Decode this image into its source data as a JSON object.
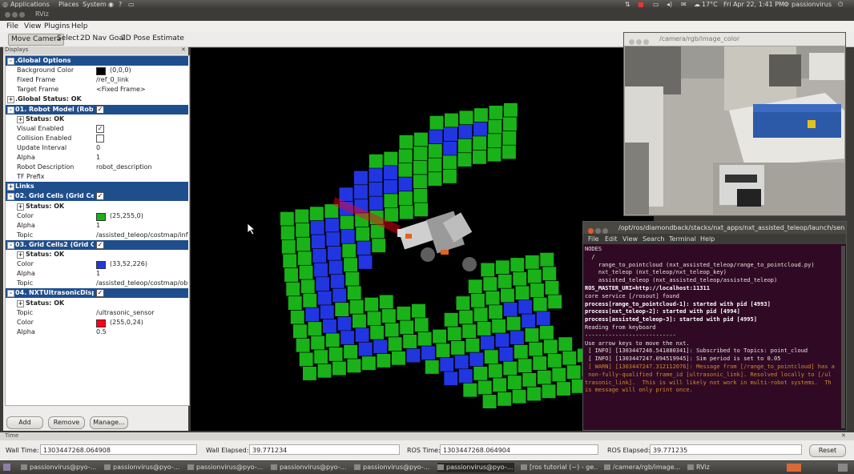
{
  "top_panel": {
    "menus": [
      "Applications",
      "Places",
      "System"
    ],
    "weather": "17°C",
    "clock": "Fri Apr 22,  1:41 PM",
    "user": "passionvirus"
  },
  "window": {
    "title": "RViz"
  },
  "menu": [
    "File",
    "View",
    "Plugins",
    "Help"
  ],
  "toolbar": [
    "Move Camera",
    "Select",
    "2D Nav Goal",
    "2D Pose Estimate"
  ],
  "displays": {
    "header": "Displays",
    "rows": [
      {
        "type": "head",
        "label": ".Global Options",
        "expander": "-"
      },
      {
        "type": "prop",
        "label": "Background Color",
        "color": "#000000",
        "value": "(0,0,0)"
      },
      {
        "type": "prop",
        "label": "Fixed Frame",
        "value": "/ref_0_link"
      },
      {
        "type": "prop",
        "label": "Target Frame",
        "value": "<Fixed Frame>"
      },
      {
        "type": "sub0",
        "label": ".Global Status: OK",
        "expander": "+"
      },
      {
        "type": "head",
        "label": "01. Robot Model (Robot",
        "expander": "-",
        "check": true
      },
      {
        "type": "sub",
        "label": "Status: OK",
        "expander": "+"
      },
      {
        "type": "prop",
        "label": "Visual Enabled",
        "check": true
      },
      {
        "type": "prop",
        "label": "Collision Enabled",
        "check": false
      },
      {
        "type": "prop",
        "label": "Update Interval",
        "value": "0"
      },
      {
        "type": "prop",
        "label": "Alpha",
        "value": "1"
      },
      {
        "type": "prop",
        "label": "Robot Description",
        "value": "robot_description"
      },
      {
        "type": "prop",
        "label": "TF Prefix",
        "value": ""
      },
      {
        "type": "head",
        "label": "Links",
        "expander": "+"
      },
      {
        "type": "head",
        "label": "02. Grid Cells (Grid Cells",
        "expander": "-",
        "check": true
      },
      {
        "type": "sub",
        "label": "Status: OK",
        "expander": "+"
      },
      {
        "type": "prop",
        "label": "Color",
        "color": "#19b219",
        "value": "(25,255,0)"
      },
      {
        "type": "prop",
        "label": "Alpha",
        "value": "1"
      },
      {
        "type": "prop",
        "label": "Topic",
        "value": "/assisted_teleop/costmap/infl"
      },
      {
        "type": "head",
        "label": "03. Grid Cells2 (Grid Cell",
        "expander": "-",
        "check": true
      },
      {
        "type": "sub",
        "label": "Status: OK",
        "expander": "+"
      },
      {
        "type": "prop",
        "label": "Color",
        "color": "#2136e0",
        "value": "(33,52,226)"
      },
      {
        "type": "prop",
        "label": "Alpha",
        "value": "1"
      },
      {
        "type": "prop",
        "label": "Topic",
        "value": "/assisted_teleop/costmap/obs"
      },
      {
        "type": "head",
        "label": "04. NXTUltrasonicDisplay",
        "expander": "-",
        "check": true
      },
      {
        "type": "sub",
        "label": "Status: OK",
        "expander": "+"
      },
      {
        "type": "prop",
        "label": "Topic",
        "value": "/ultrasonic_sensor"
      },
      {
        "type": "prop",
        "label": "Color",
        "color": "#ff0018",
        "value": "(255,0,24)"
      },
      {
        "type": "prop",
        "label": "Alpha",
        "value": "0.5"
      }
    ],
    "buttons": {
      "add": "Add",
      "remove": "Remove",
      "manage": "Manage..."
    }
  },
  "camera_window": {
    "title": "/camera/rgb/image_color"
  },
  "terminal": {
    "title": "/opt/ros/diamondback/stacks/nxt_apps/nxt_assisted_teleop/launch/sen",
    "menu": [
      "File",
      "Edit",
      "View",
      "Search",
      "Terminal",
      "Help"
    ],
    "lines": [
      {
        "t": "NODES",
        "s": ""
      },
      {
        "t": "  /",
        "s": ""
      },
      {
        "t": "    range_to_pointcloud (nxt_assisted_teleop/range_to_pointcloud.py)",
        "s": ""
      },
      {
        "t": "    nxt_teleop (nxt_teleop/nxt_teleop_key)",
        "s": ""
      },
      {
        "t": "    assisted_teleop (nxt_assisted_teleop/assisted_teleop)",
        "s": ""
      },
      {
        "t": "",
        "s": ""
      },
      {
        "t": "ROS_MASTER_URI=http://localhost:11311",
        "s": "b"
      },
      {
        "t": "",
        "s": ""
      },
      {
        "t": "core service [/rosout] found",
        "s": ""
      },
      {
        "t": "process[range_to_pointcloud-1]: started with pid [4993]",
        "s": "b"
      },
      {
        "t": "process[nxt_teleop-2]: started with pid [4994]",
        "s": "b"
      },
      {
        "t": "process[assisted_teleop-3]: started with pid [4995]",
        "s": "b"
      },
      {
        "t": "Reading from keyboard",
        "s": ""
      },
      {
        "t": "---------------------------",
        "s": ""
      },
      {
        "t": "Use arrow keys to move the nxt.",
        "s": ""
      },
      {
        "t": " [ INFO] [1303447246.541880341]: Subscribed to Topics: point_cloud",
        "s": ""
      },
      {
        "t": " [ INFO] [1303447247.094519945]: Sim period is set to 0.05",
        "s": ""
      },
      {
        "t": " [ WARN] [1303447247.312112076]: Message from [/range_to_pointcloud] has a",
        "s": "w"
      },
      {
        "t": " non-fully-qualified frame_id [ultrasonic_link]. Resolved locally to [/ul",
        "s": "w"
      },
      {
        "t": "trasonic_link].  This is will likely not work in multi-robot systems.  Th",
        "s": "w"
      },
      {
        "t": "is message will only print once.",
        "s": "w"
      }
    ]
  },
  "time": {
    "header": "Time",
    "wall_time_label": "Wall Time:",
    "wall_time": "1303447268.064908",
    "wall_elapsed_label": "Wall Elapsed:",
    "wall_elapsed": "39.771234",
    "ros_time_label": "ROS Time:",
    "ros_time": "1303447268.064904",
    "ros_elapsed_label": "ROS Elapsed:",
    "ros_elapsed": "39.771235",
    "reset": "Reset"
  },
  "taskbar": [
    "passionvirus@pyo-...",
    "passionvirus@pyo-...",
    "passionvirus@pyo-...",
    "passionvirus@pyo-...",
    "passionvirus@pyo-...",
    "passionvirus@pyo-...",
    "[ros tutorial (~) - ge...",
    "/camera/rgb/image...",
    "RViz"
  ],
  "colors": {
    "green_cell": "#19b219",
    "blue_cell": "#2136e0",
    "selection": "#1f4e8d"
  }
}
